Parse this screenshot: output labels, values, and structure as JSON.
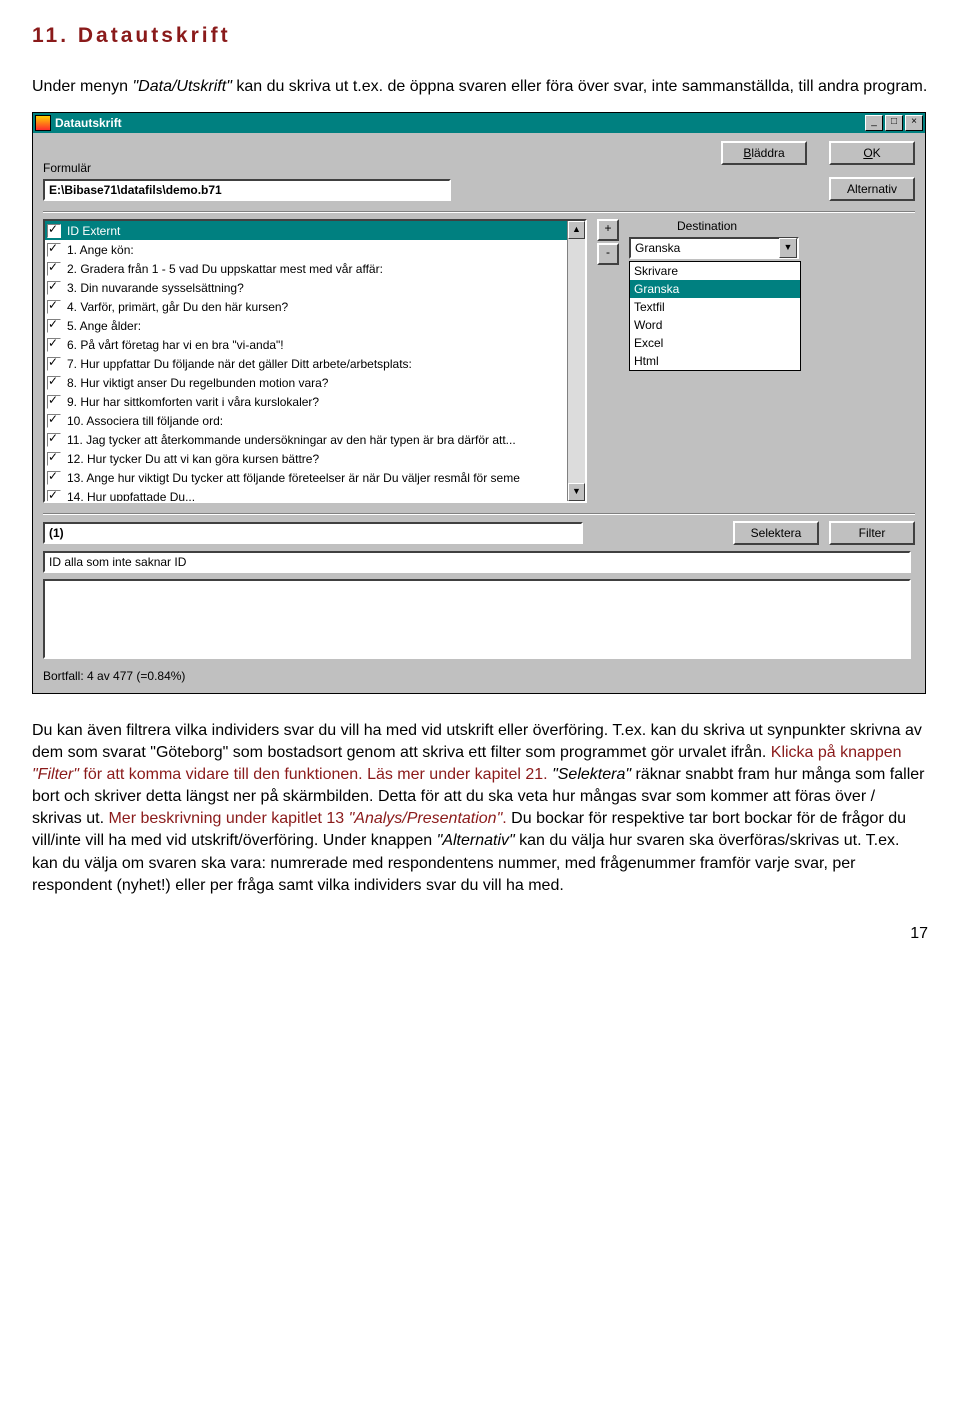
{
  "doc": {
    "section_heading": "11. Datautskrift",
    "intro_a": "Under menyn ",
    "intro_kw1": "\"Data/Utskrift\"",
    "intro_b": " kan du skriva ut t.ex. de öppna svaren eller föra över svar, inte sammanställda, till andra program.",
    "para2_a": "Du kan även filtrera vilka individers svar du vill ha med vid utskrift eller överföring. T.ex. kan du skriva ut synpunkter skrivna av dem som svarat \"Göteborg\" som bostadsort genom att skriva ett filter som programmet gör urvalet ifrån. ",
    "para2_red1_a": "Klicka på knappen ",
    "para2_kw_filter": "\"Filter\"",
    "para2_red1_b": " för att komma vidare till den funktionen. Läs mer under kapitel 21.",
    "para2_b": " ",
    "para2_kw_sel": "\"Selektera\"",
    "para2_c": " räknar snabbt fram hur många som faller bort och skriver detta längst ner på skärmbilden. Detta för att du ska veta hur mångas svar som kommer att föras över / skrivas ut. ",
    "para2_red2_a": "Mer beskrivning under kapitlet 13 ",
    "para2_kw_ap": "\"Analys/Presentation\"",
    "para2_red2_b": ".",
    "para2_d": " Du bockar för respektive tar bort bockar för de frågor du vill/inte vill ha med vid utskrift/överföring. Under knappen ",
    "para2_kw_alt": "\"Alternativ\"",
    "para2_e": " kan du välja hur svaren ska överföras/skrivas ut. T.ex. kan du välja om svaren ska vara: numrerade med respondentens nummer, med frågenummer framför varje svar, per respondent (nyhet!) eller per fråga samt vilka individers svar du vill ha med.",
    "page_number": "17"
  },
  "app": {
    "title": "Datautskrift",
    "form_label": "Formulär",
    "path": "E:\\Bibase71\\datafils\\demo.b71",
    "btn_bladdra": "Bläddra",
    "btn_ok": "OK",
    "btn_alternativ": "Alternativ",
    "btn_plus": "+",
    "btn_minus": "-",
    "dest_label": "Destination",
    "dest_selected": "Granska",
    "dest_options": [
      "Skrivare",
      "Granska",
      "Textfil",
      "Word",
      "Excel",
      "Html"
    ],
    "count_text": "(1)",
    "btn_selektera": "Selektera",
    "btn_filter": "Filter",
    "id_text": "ID  alla som inte saknar ID",
    "status": "Bortfall: 4 av 477 (=0.84%)",
    "questions": [
      "ID Externt",
      "1. Ange kön:",
      "2. Gradera från 1 - 5 vad Du uppskattar mest med vår affär:",
      "3. Din nuvarande sysselsättning?",
      "4. Varför, primärt, går Du den här kursen?",
      "5. Ange ålder:",
      "6. På vårt företag har vi en bra \"vi-anda\"!",
      "7. Hur uppfattar Du följande när det gäller Ditt arbete/arbetsplats:",
      "8. Hur viktigt anser Du regelbunden motion vara?",
      "9. Hur har sittkomforten varit i våra kurslokaler?",
      "10. Associera till följande ord:",
      "11. Jag tycker att återkommande undersökningar av den här typen är bra därför att...",
      "12. Hur tycker Du att vi kan göra kursen bättre?",
      "13. Ange hur viktigt Du tycker att följande företeelser är när Du väljer resmål för seme",
      "14. Hur uppfattade Du..."
    ]
  }
}
